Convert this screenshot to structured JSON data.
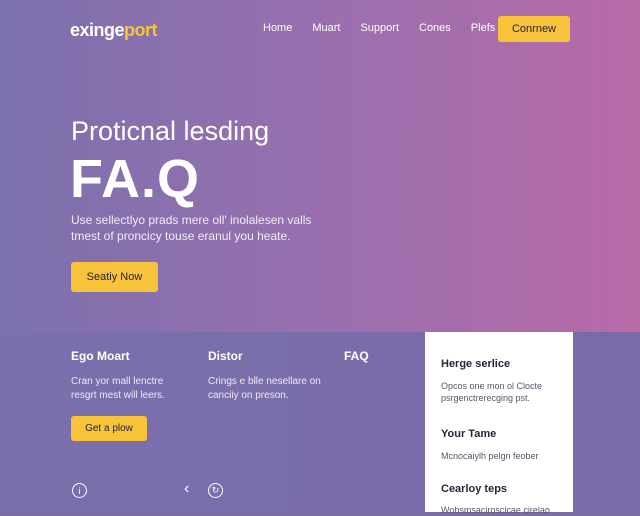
{
  "header": {
    "logo_main": "exinge",
    "logo_accent": "port",
    "nav": [
      "Home",
      "Muart",
      "Support",
      "Cones",
      "Plefs"
    ],
    "cta_label": "Conrnew"
  },
  "hero": {
    "kicker": "Proticnal lesding",
    "title": "FA.Q",
    "description": "Use sellectlyo prads mere oll' inolalesen valls tmest of proncicy touse eranul you heate.",
    "button_label": "Seatiy Now"
  },
  "features": [
    {
      "title": "Ego Moart",
      "text": "Cran yor mall lenctre resgrt mest will leers."
    },
    {
      "title": "Distor",
      "text": "Crings e blle nesellare on canciiy on preson."
    },
    {
      "title": "FAQ",
      "text": ""
    }
  ],
  "features_button_label": "Get a plow",
  "panel": [
    {
      "title": "Herge serlice",
      "text": "Opcos one mon ol Clocte psrgenctrerecging pst."
    },
    {
      "title": "Your Tame",
      "text": "Mcnocaiylh pelgn feober"
    },
    {
      "title": "Cearloy teps",
      "text": "Wohsmsaciroscicae cirelao"
    }
  ],
  "icons": {
    "info": "info-icon",
    "back": "chevron-left-icon",
    "settings": "settings-icon"
  },
  "colors": {
    "accent": "#f7c33a",
    "gradient_start": "#7b71ad",
    "gradient_end": "#b96aa7"
  }
}
